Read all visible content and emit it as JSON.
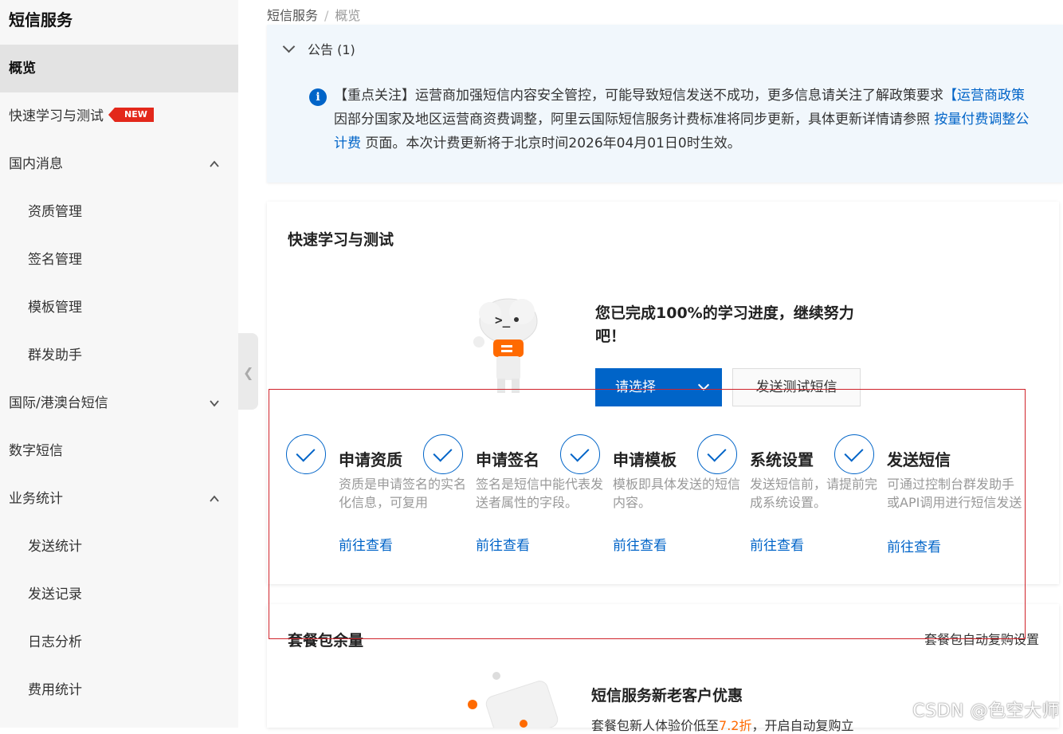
{
  "sidebar": {
    "title": "短信服务",
    "items": [
      {
        "label": "概览"
      },
      {
        "label": "快速学习与测试",
        "badge": "NEW"
      },
      {
        "label": "国内消息"
      },
      {
        "label": "资质管理"
      },
      {
        "label": "签名管理"
      },
      {
        "label": "模板管理"
      },
      {
        "label": "群发助手"
      },
      {
        "label": "国际/港澳台短信"
      },
      {
        "label": "数字短信"
      },
      {
        "label": "业务统计"
      },
      {
        "label": "发送统计"
      },
      {
        "label": "发送记录"
      },
      {
        "label": "日志分析"
      },
      {
        "label": "费用统计"
      }
    ]
  },
  "breadcrumb": {
    "root": "短信服务",
    "separator": "/",
    "current": "概览"
  },
  "notice": {
    "header": "公告 (1)",
    "lead": "【重点关注】运营商加强短信内容安全管控，可能导致短信发送不成功，更多信息请关注了解政策要求",
    "policy_link": "【运营商政策",
    "line2": "因部分国家及地区运营商资费调整，阿里云国际短信服务计费标准将同步更新，具体更新详情请参照 ",
    "billing_link_a": "按量付费调整公",
    "billing_link_b": "计费",
    "tail": " 页面。本次计费更新将于北京时间2026年04月01日0时生效。"
  },
  "learn": {
    "title": "快速学习与测试",
    "progress": "您已完成100%的学习进度，继续努力吧！",
    "select_label": "请选择",
    "test_label": "发送测试短信",
    "steps": [
      {
        "title": "申请资质",
        "desc": "资质是申请签名的实名化信息，可复用",
        "link": "前往查看"
      },
      {
        "title": "申请签名",
        "desc": "签名是短信中能代表发送者属性的字段。",
        "link": "前往查看"
      },
      {
        "title": "申请模板",
        "desc": "模板即具体发送的短信内容。",
        "link": "前往查看"
      },
      {
        "title": "系统设置",
        "desc": "发送短信前，请提前完成系统设置。",
        "link": "前往查看"
      },
      {
        "title": "发送短信",
        "desc": "可通过控制台群发助手或API调用进行短信发送",
        "link": "前往查看"
      }
    ]
  },
  "package": {
    "title": "套餐包余量",
    "settings_link": "套餐包自动复购设置",
    "promo_title": "短信服务新老客户优惠",
    "promo_text_a": "套餐包新人体验价低至",
    "promo_highlight": "7.2折",
    "promo_text_b": "，开启自动复购立"
  },
  "watermark": "CSDN @色空大师",
  "colors": {
    "accent": "#0064c8",
    "badge": "#e3281b",
    "highlight": "#ff6a00",
    "annotation_box": "#d0232b"
  }
}
